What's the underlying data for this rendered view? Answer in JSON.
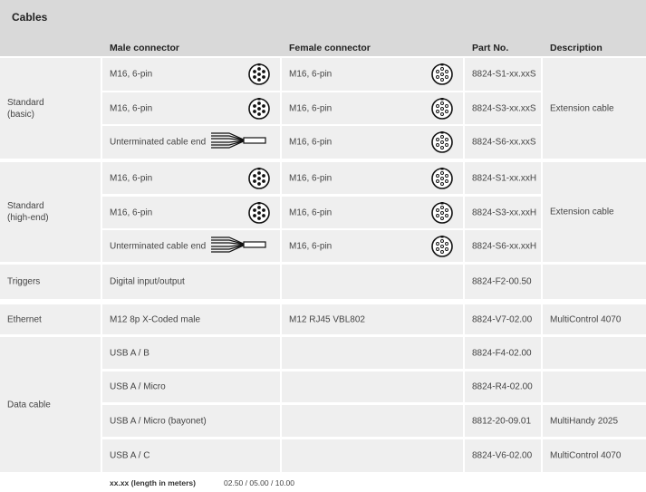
{
  "title": "Cables",
  "headers": {
    "male": "Male connector",
    "female": "Female connector",
    "part": "Part No.",
    "desc": "Description"
  },
  "groups": {
    "standard_basic": "Standard\n(basic)",
    "standard_highend": "Standard\n(high-end)",
    "triggers": "Triggers",
    "ethernet": "Ethernet",
    "data_cable": "Data cable"
  },
  "rows": [
    {
      "male": "M16, 6-pin",
      "female": "M16, 6-pin",
      "part": "8824-S1-xx.xxS",
      "desc": ""
    },
    {
      "male": "M16, 6-pin",
      "female": "M16, 6-pin",
      "part": "8824-S3-xx.xxS",
      "desc": "Extension cable"
    },
    {
      "male": "Unterminated cable end",
      "female": "M16, 6-pin",
      "part": "8824-S6-xx.xxS",
      "desc": ""
    },
    {
      "male": "M16, 6-pin",
      "female": "M16, 6-pin",
      "part": "8824-S1-xx.xxH",
      "desc": ""
    },
    {
      "male": "M16, 6-pin",
      "female": "M16, 6-pin",
      "part": "8824-S3-xx.xxH",
      "desc": "Extension cable"
    },
    {
      "male": "Unterminated cable end",
      "female": "M16, 6-pin",
      "part": "8824-S6-xx.xxH",
      "desc": ""
    },
    {
      "male": "Digital input/output",
      "female": "",
      "part": "8824-F2-00.50",
      "desc": ""
    },
    {
      "male": "M12 8p X-Coded male",
      "female": "M12 RJ45 VBL802",
      "part": "8824-V7-02.00",
      "desc": "MultiControl 4070"
    },
    {
      "male": "USB A / B",
      "female": "",
      "part": "8824-F4-02.00",
      "desc": ""
    },
    {
      "male": "USB A / Micro",
      "female": "",
      "part": "8824-R4-02.00",
      "desc": ""
    },
    {
      "male": "USB A / Micro (bayonet)",
      "female": "",
      "part": "8812-20-09.01",
      "desc": "MultiHandy 2025"
    },
    {
      "male": "USB A / C",
      "female": "",
      "part": "8824-V6-02.00",
      "desc": "MultiControl 4070"
    }
  ],
  "footer": {
    "label": "xx.xx (length in meters)",
    "value": "02.50 / 05.00 / 10.00"
  },
  "icons": {
    "male": "male-6pin-connector-icon",
    "female": "female-6pin-connector-icon",
    "cable": "unterminated-cable-end-icon"
  }
}
